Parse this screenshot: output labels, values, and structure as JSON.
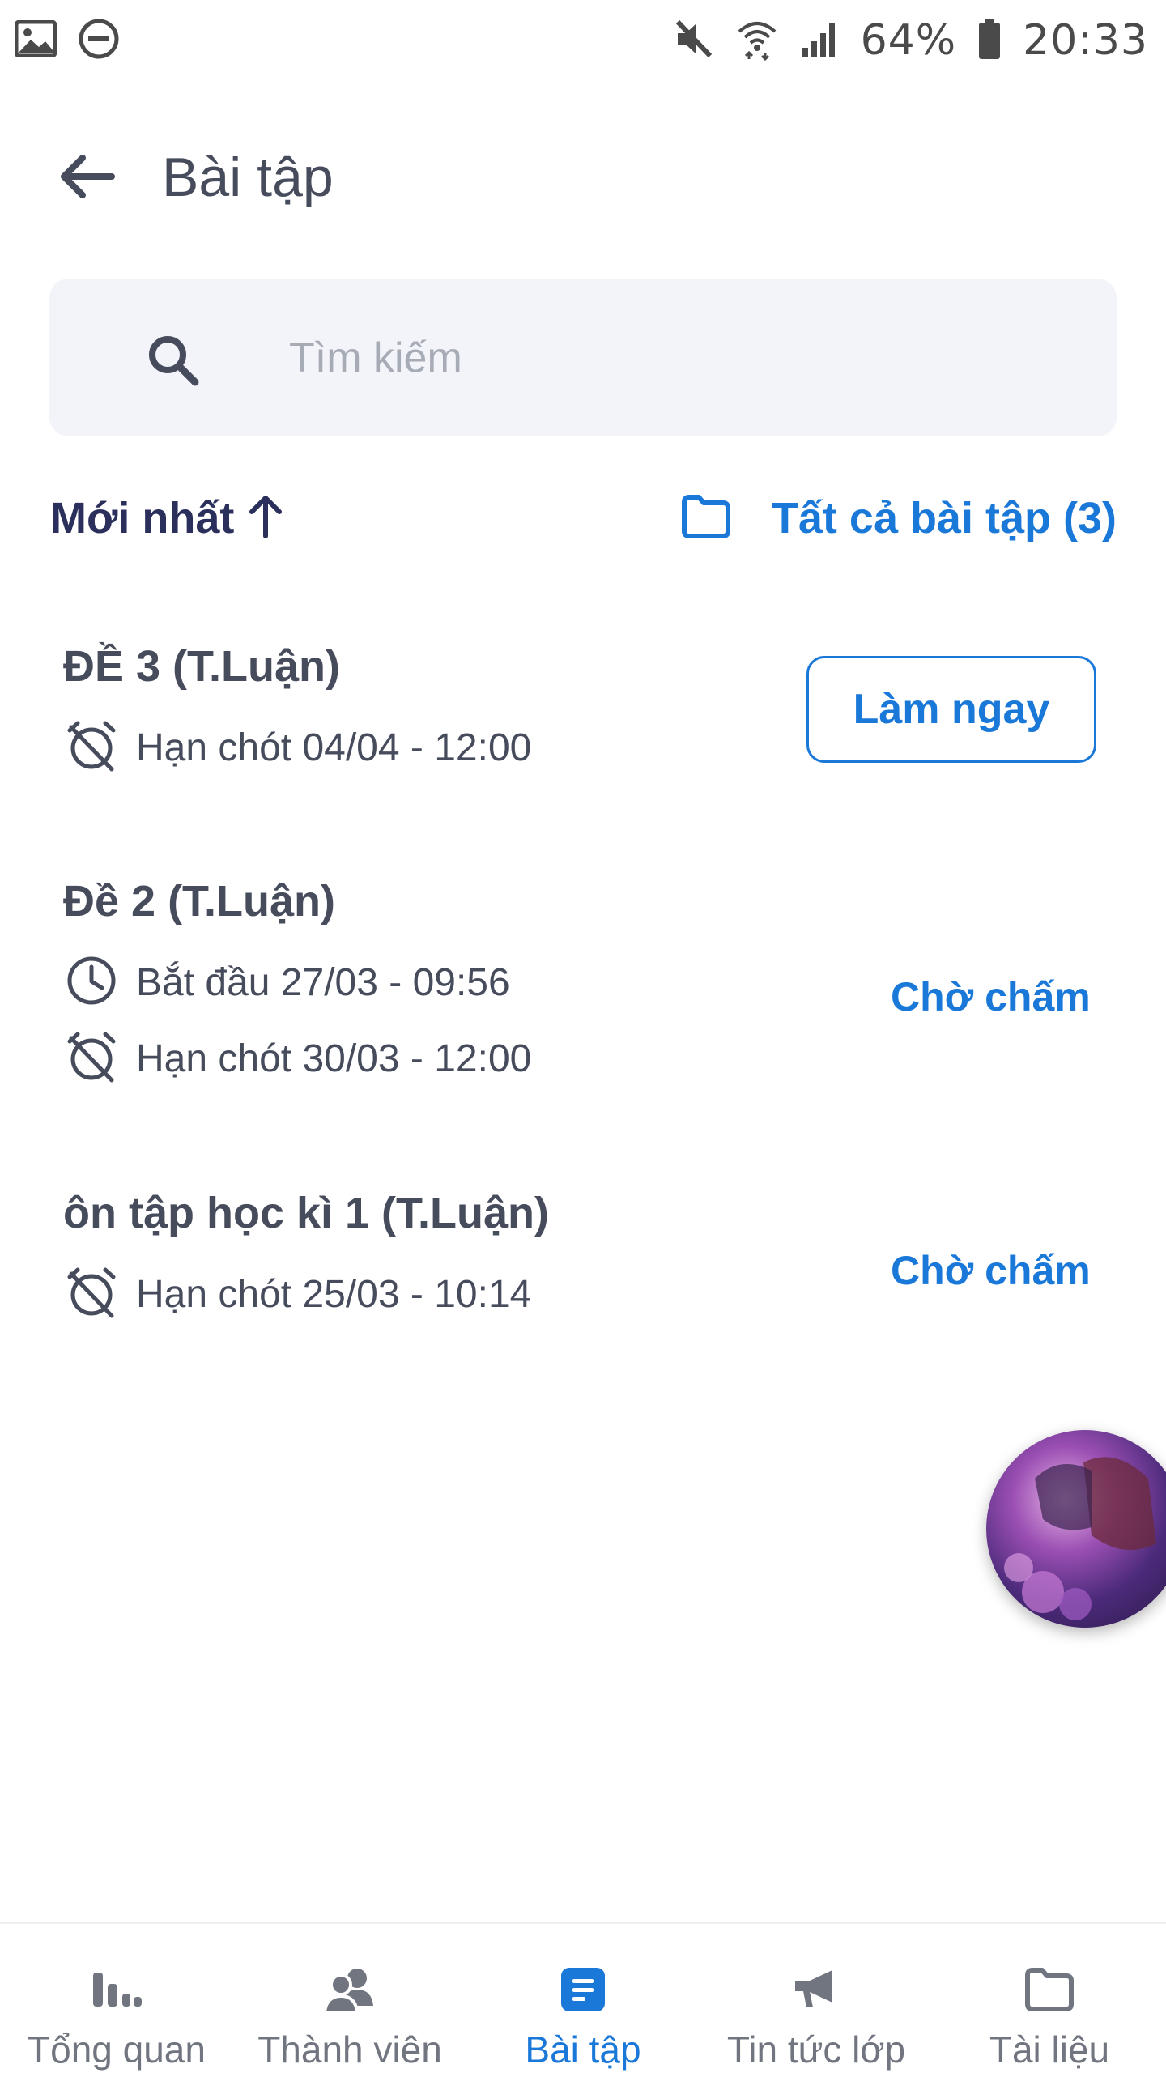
{
  "status_bar": {
    "battery": "64%",
    "time": "20:33",
    "icons": [
      "image-icon",
      "do-not-disturb-icon",
      "mute-icon",
      "wifi-icon",
      "signal-icon",
      "battery-icon"
    ]
  },
  "header": {
    "title": "Bài tập",
    "back_icon": "arrow-left-icon"
  },
  "search": {
    "placeholder": "Tìm kiếm",
    "value": ""
  },
  "sort": {
    "label": "Mới nhất",
    "direction_icon": "arrow-up-icon"
  },
  "filter": {
    "label": "Tất cả bài tập (3)",
    "icon": "folder-icon"
  },
  "assignments": [
    {
      "title": "ĐỀ 3 (T.Luận)",
      "deadline": "Hạn chót 04/04 - 12:00",
      "action_label": "Làm ngay"
    },
    {
      "title": "Đề 2 (T.Luận)",
      "start": "Bắt đầu 27/03 - 09:56",
      "deadline": "Hạn chót 30/03 - 12:00",
      "status": "Chờ chấm"
    },
    {
      "title": "ôn tập học kì 1 (T.Luận)",
      "deadline": "Hạn chót 25/03 - 10:14",
      "status": "Chờ chấm"
    }
  ],
  "bottom_nav": [
    {
      "label": "Tổng quan",
      "icon": "bar-chart-icon",
      "active": false
    },
    {
      "label": "Thành viên",
      "icon": "members-icon",
      "active": false
    },
    {
      "label": "Bài tập",
      "icon": "assignment-icon",
      "active": true
    },
    {
      "label": "Tin tức lớp",
      "icon": "megaphone-icon",
      "active": false
    },
    {
      "label": "Tài liệu",
      "icon": "folder-icon",
      "active": false
    }
  ],
  "colors": {
    "accent": "#1a78d8",
    "text": "#474c5d",
    "sort_text": "#2a2f5b",
    "search_bg": "#f2f4f9",
    "nav_inactive": "#70757f"
  }
}
